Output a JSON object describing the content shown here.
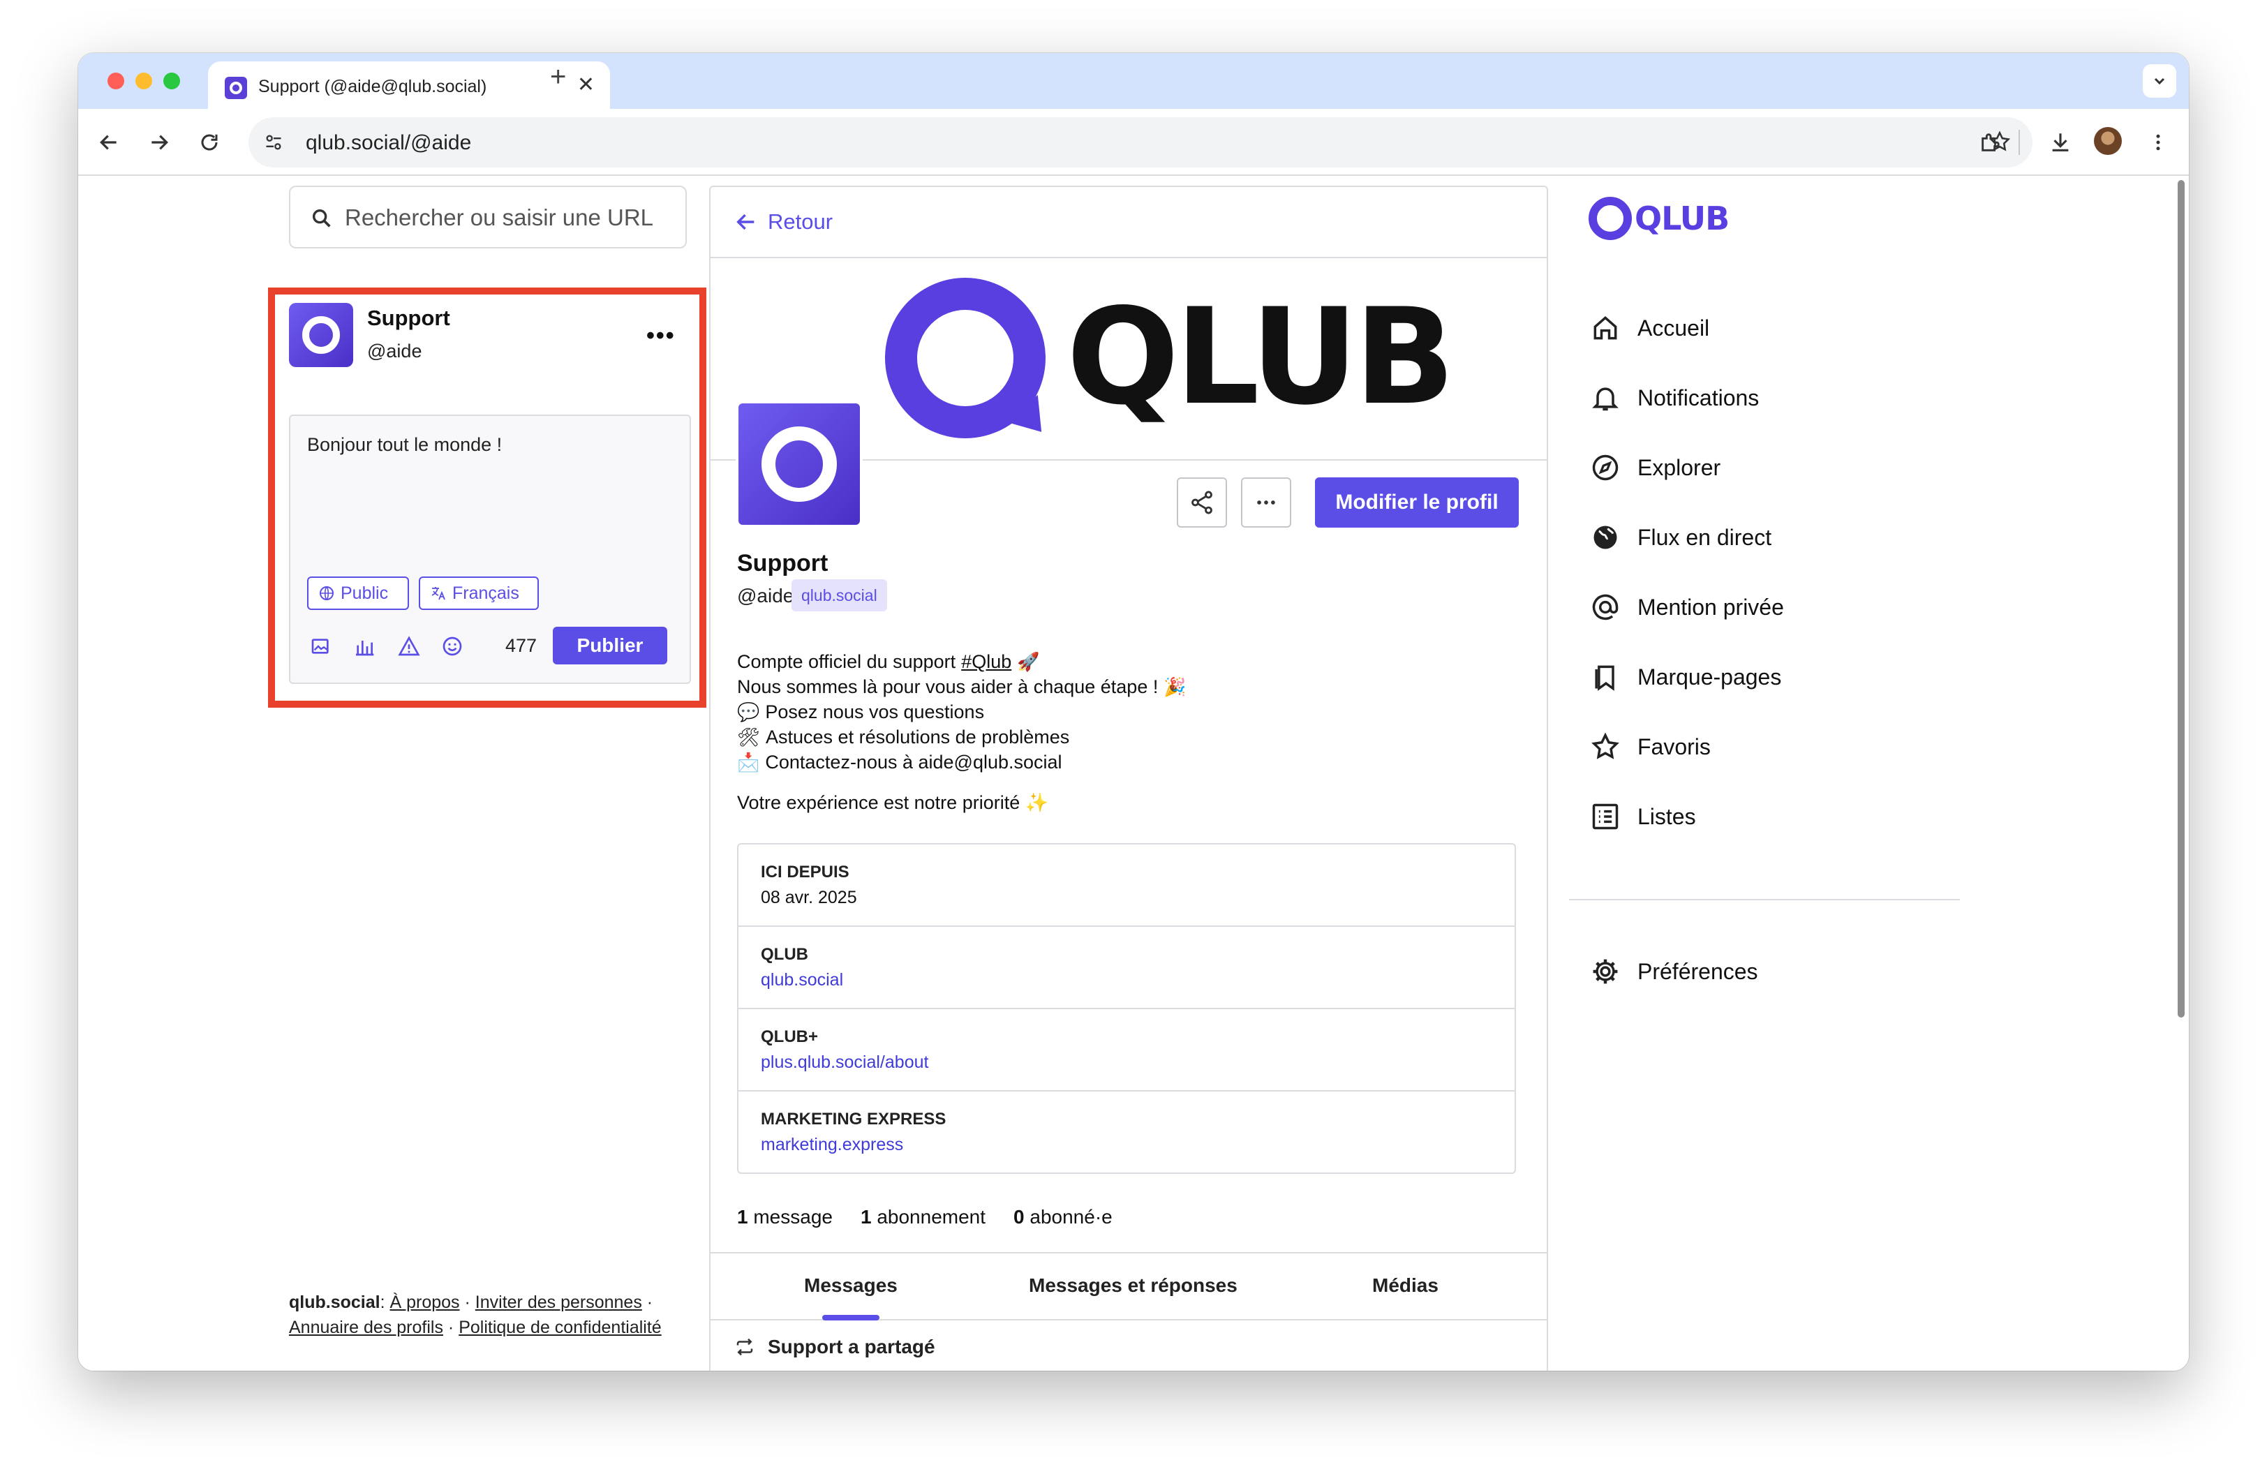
{
  "browser": {
    "tab_title": "Support (@aide@qlub.social)",
    "tab_close": "✕",
    "new_tab": "+",
    "url": "qlub.social/@aide"
  },
  "left": {
    "search_placeholder": "Rechercher ou saisir une URL",
    "compose": {
      "name": "Support",
      "handle": "@aide",
      "more": "•••",
      "text": "Bonjour tout le monde !",
      "visibility": "Public",
      "language": "Français",
      "char_count": "477",
      "publish": "Publier"
    },
    "footer": {
      "site": "qlub.social",
      "colon": ":",
      "about": "À propos",
      "invite": "Inviter des personnes",
      "directory": "Annuaire des profils",
      "privacy": "Politique de confidentialité",
      "sep": "·"
    }
  },
  "profile": {
    "back": "Retour",
    "banner_word": "QLUB",
    "edit": "Modifier le profil",
    "name": "Support",
    "handle": "@aide",
    "domain": "qlub.social",
    "bio": {
      "l1_pre": "Compte officiel du support",
      "l1_tag": "#Qlub",
      "l1_emoji": "🚀",
      "l2_text": "Nous sommes là pour vous aider à chaque étape !",
      "l2_emoji": "🎉",
      "l3_emoji": "💬",
      "l3_text": "Posez nous vos questions",
      "l4_emoji": "🛠",
      "l4_text": "Astuces et résolutions de problèmes",
      "l5_emoji": "📩",
      "l5_text": "Contactez-nous à aide@qlub.social",
      "tail_text": "Votre expérience est notre priorité",
      "tail_emoji": "✨"
    },
    "fields": [
      {
        "label": "ICI DEPUIS",
        "value": "08 avr. 2025"
      },
      {
        "label": "QLUB",
        "value": "qlub.social"
      },
      {
        "label": "QLUB+",
        "value": "plus.qlub.social/about"
      },
      {
        "label": "MARKETING EXPRESS",
        "value": "marketing.express"
      }
    ],
    "stats": {
      "posts_n": "1",
      "posts_label": "message",
      "following_n": "1",
      "following_label": "abonnement",
      "followers_n": "0",
      "followers_label": "abonné·e"
    },
    "tabs": [
      "Messages",
      "Messages et réponses",
      "Médias"
    ],
    "shared": "Support a partagé"
  },
  "nav": {
    "logo": "QLUB",
    "items": [
      {
        "label": "Accueil",
        "icon": "home-icon"
      },
      {
        "label": "Notifications",
        "icon": "bell-icon"
      },
      {
        "label": "Explorer",
        "icon": "compass-icon"
      },
      {
        "label": "Flux en direct",
        "icon": "globe-icon"
      },
      {
        "label": "Mention privée",
        "icon": "at-icon"
      },
      {
        "label": "Marque-pages",
        "icon": "bookmark-icon"
      },
      {
        "label": "Favoris",
        "icon": "star-icon"
      },
      {
        "label": "Listes",
        "icon": "list-icon"
      }
    ],
    "preferences": "Préférences"
  },
  "colors": {
    "accent": "#5a4ee6",
    "brand": "#5a3fe0",
    "highlight": "#e8412c"
  }
}
